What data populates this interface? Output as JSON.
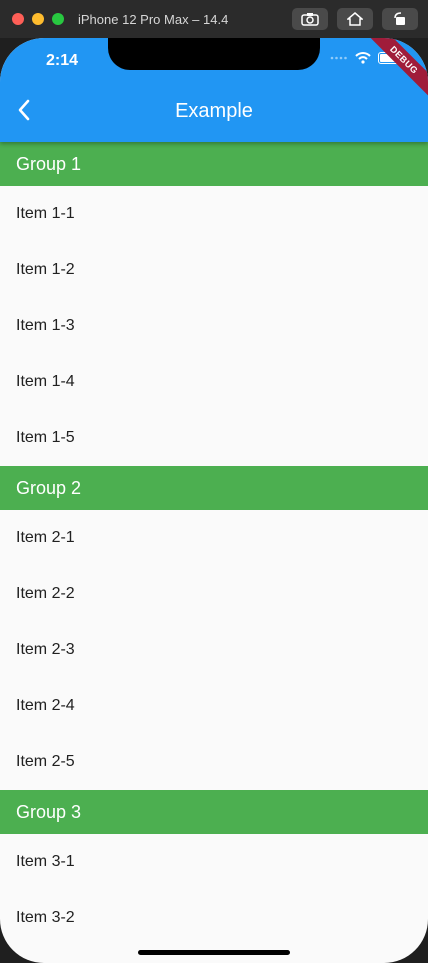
{
  "simulator": {
    "title": "iPhone 12 Pro Max – 14.4"
  },
  "status": {
    "time": "2:14"
  },
  "appbar": {
    "title": "Example",
    "debug_label": "DEBUG"
  },
  "groups": [
    {
      "header": "Group 1",
      "items": [
        "Item 1-1",
        "Item 1-2",
        "Item 1-3",
        "Item 1-4",
        "Item 1-5"
      ]
    },
    {
      "header": "Group 2",
      "items": [
        "Item 2-1",
        "Item 2-2",
        "Item 2-3",
        "Item 2-4",
        "Item 2-5"
      ]
    },
    {
      "header": "Group 3",
      "items": [
        "Item 3-1",
        "Item 3-2"
      ]
    }
  ],
  "colors": {
    "appbar": "#2196f3",
    "group_header": "#4caf50",
    "background": "#fafafa"
  }
}
